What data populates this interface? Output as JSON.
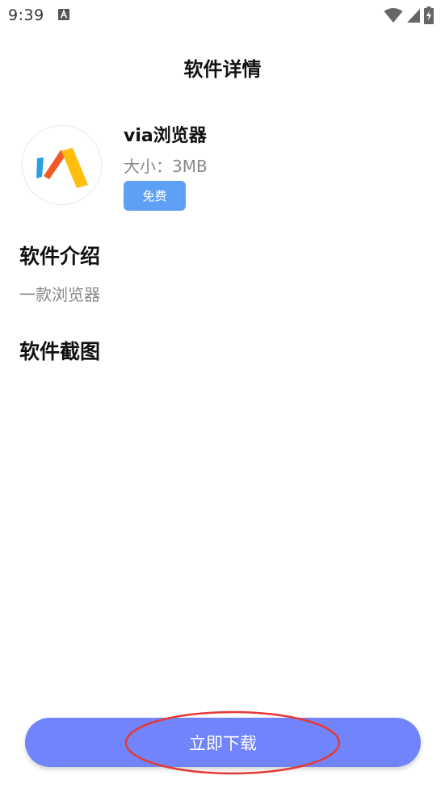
{
  "status_bar": {
    "time": "9:39",
    "icons": [
      "a-notification-icon",
      "wifi-icon",
      "cell-signal-icon",
      "battery-charging-icon"
    ]
  },
  "header": {
    "title": "软件详情"
  },
  "app": {
    "name": "via浏览器",
    "size": "大小：3MB",
    "price": "免费",
    "logo": "via-browser-logo-icon"
  },
  "intro": {
    "title": "软件介绍",
    "text": "一款浏览器"
  },
  "screenshots": {
    "title": "软件截图"
  },
  "actions": {
    "download_label": "立即下载"
  },
  "colors": {
    "button": "#7284fb",
    "badge": "#5ea0f5",
    "highlight": "#e53935"
  }
}
